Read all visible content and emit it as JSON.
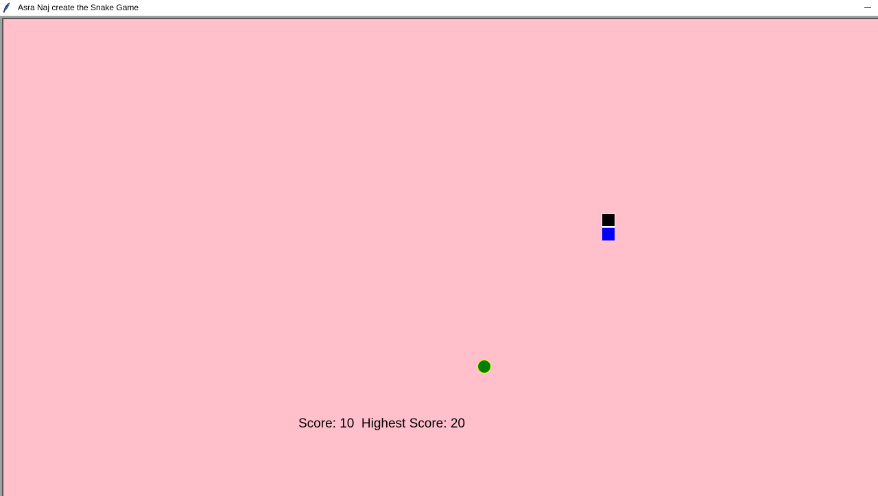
{
  "window": {
    "title": "Asra Naj create the Snake Game",
    "minimize_label": "—"
  },
  "icons": {
    "app": "feather-icon",
    "minimize": "minimize-icon"
  },
  "game": {
    "background_color": "#ffc0cb",
    "snake_head_color": "#000000",
    "snake_body_color": "#0000ff",
    "food_color": "#008000",
    "food_outline_color": "#ffff00"
  },
  "score": {
    "label": "Score:",
    "value": "10",
    "highest_label": "Highest Score:",
    "highest_value": "20"
  }
}
